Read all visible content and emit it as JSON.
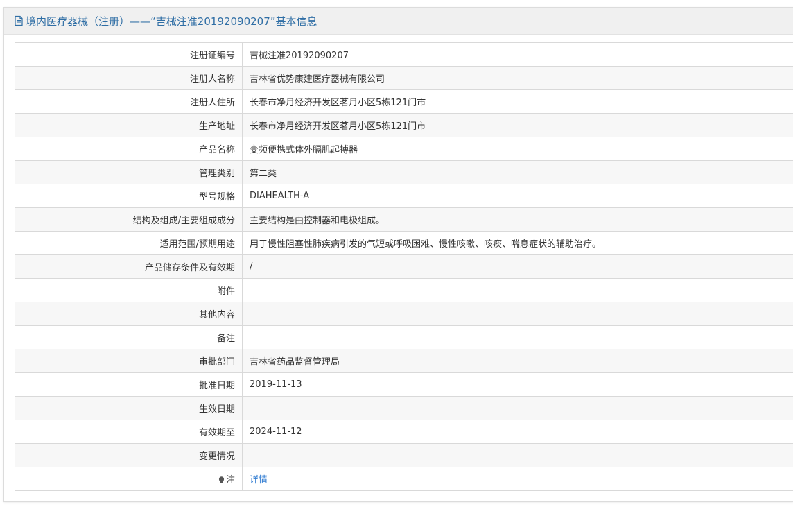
{
  "header": {
    "title": "境内医疗器械（注册）——“吉械注准20192090207”基本信息",
    "icon": "document-icon"
  },
  "rows": [
    {
      "label": "注册证编号",
      "value": "吉械注准20192090207"
    },
    {
      "label": "注册人名称",
      "value": "吉林省优势康建医疗器械有限公司"
    },
    {
      "label": "注册人住所",
      "value": "长春市净月经济开发区茗月小区5栋121门市"
    },
    {
      "label": "生产地址",
      "value": "长春市净月经济开发区茗月小区5栋121门市"
    },
    {
      "label": "产品名称",
      "value": "变频便携式体外膈肌起搏器"
    },
    {
      "label": "管理类别",
      "value": "第二类"
    },
    {
      "label": "型号规格",
      "value": "DIAHEALTH-A"
    },
    {
      "label": "结构及组成/主要组成成分",
      "value": "主要结构是由控制器和电极组成。"
    },
    {
      "label": "适用范围/预期用途",
      "value": "用于慢性阻塞性肺疾病引发的气短或呼吸困难、慢性咳嗽、咳痰、喘息症状的辅助治疗。"
    },
    {
      "label": "产品储存条件及有效期",
      "value": "/"
    },
    {
      "label": "附件",
      "value": ""
    },
    {
      "label": "其他内容",
      "value": ""
    },
    {
      "label": "备注",
      "value": ""
    },
    {
      "label": "审批部门",
      "value": "吉林省药品监督管理局"
    },
    {
      "label": "批准日期",
      "value": "2019-11-13"
    },
    {
      "label": "生效日期",
      "value": ""
    },
    {
      "label": "有效期至",
      "value": "2024-11-12"
    },
    {
      "label": "变更情况",
      "value": ""
    }
  ],
  "note": {
    "label": "注",
    "icon": "lightbulb-icon",
    "link_text": "详情"
  },
  "colors": {
    "title": "#2f6ea5",
    "link": "#2f7bd1",
    "header_bg": "#f0f0f0",
    "row_alt_bg": "#f7f7f7",
    "border": "#d9d9d9"
  }
}
